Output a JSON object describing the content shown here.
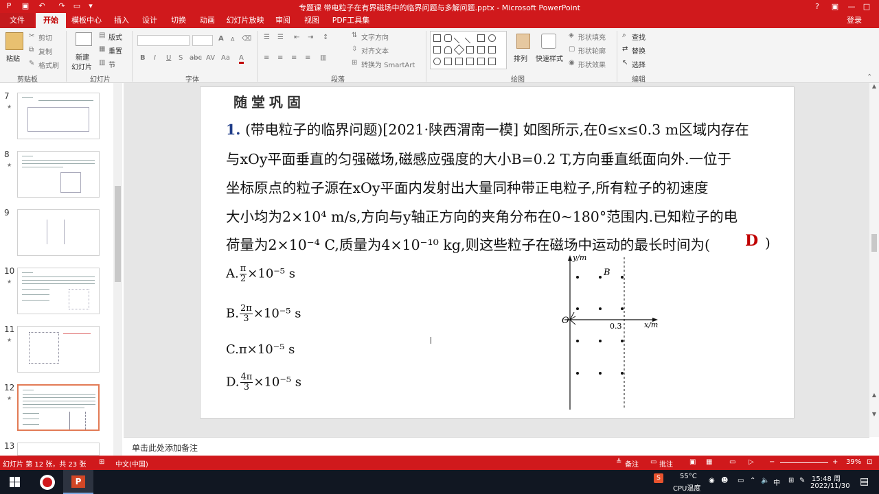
{
  "window": {
    "title": "专题课 带电粒子在有界磁场中的临界问题与多解问题.pptx - Microsoft PowerPoint",
    "login": "登录"
  },
  "tabs": [
    "文件",
    "开始",
    "模板中心",
    "插入",
    "设计",
    "切换",
    "动画",
    "幻灯片放映",
    "审阅",
    "视图",
    "PDF工具集"
  ],
  "ribbon": {
    "clipboard": {
      "paste": "粘贴",
      "cut": "剪切",
      "copy": "复制",
      "format_painter": "格式刷",
      "label": "剪贴板"
    },
    "slides": {
      "new_slide_1": "新建",
      "new_slide_2": "幻灯片",
      "layout": "版式",
      "reset": "重置",
      "section": "节",
      "label": "幻灯片"
    },
    "font": {
      "label": "字体",
      "b": "B",
      "i": "I",
      "u": "U",
      "s": "S",
      "abc": "abc",
      "av": "AV",
      "aa": "Aa",
      "a": "A"
    },
    "paragraph": {
      "text_direction": "文字方向",
      "align_text": "对齐文本",
      "smartart": "转换为 SmartArt",
      "label": "段落"
    },
    "drawing": {
      "arrange": "排列",
      "quick_styles": "快速样式",
      "fill": "形状填充",
      "outline": "形状轮廓",
      "effects": "形状效果",
      "label": "绘图"
    },
    "editing": {
      "find": "查找",
      "replace": "替换",
      "select": "选择",
      "label": "编辑"
    }
  },
  "thumbnails": [
    {
      "num": "7"
    },
    {
      "num": "8"
    },
    {
      "num": "9"
    },
    {
      "num": "10"
    },
    {
      "num": "11"
    },
    {
      "num": "12"
    },
    {
      "num": "13"
    }
  ],
  "slide": {
    "heading": "随堂巩固",
    "q_num": "1.",
    "lines": [
      "(带电粒子的临界问题)[2021·陕西渭南一模] 如图所示,在0≤x≤0.3 m区域内存在",
      "与xOy平面垂直的匀强磁场,磁感应强度的大小B=0.2 T,方向垂直纸面向外.一位于",
      "坐标原点的粒子源在xOy平面内发射出大量同种带正电粒子,所有粒子的初速度",
      "大小均为2×10⁴ m/s,方向与y轴正方向的夹角分布在0~180°范围内.已知粒子的电",
      "荷量为2×10⁻⁴ C,质量为4×10⁻¹⁰ kg,则这些粒子在磁场中运动的最长时间为(",
      ")"
    ],
    "answer": "D",
    "options": {
      "a": {
        "pre": "A.",
        "num": "π",
        "den": "2",
        "post": "×10⁻⁵ s"
      },
      "b": {
        "pre": "B.",
        "num": "2π",
        "den": "3",
        "post": "×10⁻⁵ s"
      },
      "c": {
        "text": "C.π×10⁻⁵ s"
      },
      "d": {
        "pre": "D.",
        "num": "4π",
        "den": "3",
        "post": "×10⁻⁵ s"
      }
    },
    "diagram": {
      "y_label": "y/m",
      "x_label": "x/m",
      "origin": "O",
      "b_label": "B",
      "tick": "0.3"
    }
  },
  "notes": {
    "placeholder": "单击此处添加备注"
  },
  "statusbar": {
    "slide_info": "幻灯片 第 12 张，共 23 张",
    "language": "中文(中国)",
    "notes_btn": "备注",
    "comments_btn": "批注",
    "zoom": "39%"
  },
  "taskbar": {
    "temp": "55°C",
    "cpu": "CPU温度",
    "time": "15:48 周",
    "date": "2022/11/30"
  },
  "colors": {
    "accent": "#d0191c",
    "answer": "#c00000"
  }
}
